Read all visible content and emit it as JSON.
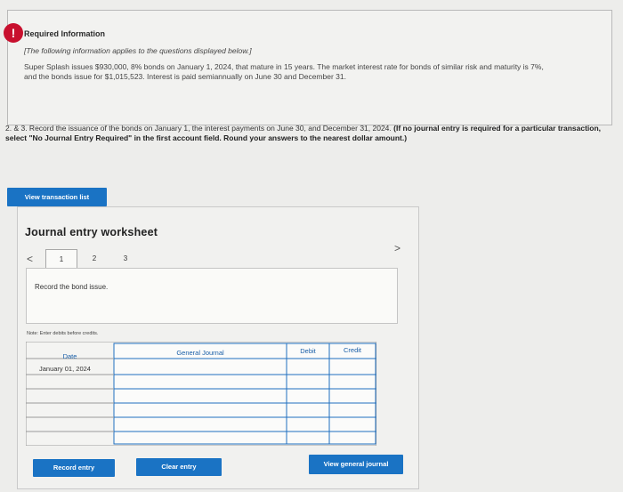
{
  "info": {
    "icon": "!",
    "title": "Required Information",
    "subtitle": "[The following information applies to the questions displayed below.]",
    "body": "Super Splash issues $930,000, 8% bonds on January 1, 2024, that mature in 15 years. The market interest rate for bonds of similar risk and maturity is 7%, and the bonds issue for $1,015,523. Interest is paid semiannually on June 30 and December 31."
  },
  "question": {
    "text": "2. & 3. Record the issuance of the bonds on January 1, the interest payments on June 30, and December 31, 2024.",
    "bold": "(If no journal entry is required for a particular transaction, select \"No Journal Entry Required\" in the first account field. Round your answers to the nearest dollar amount.)"
  },
  "buttons": {
    "view_transaction_list": "View transaction list",
    "record_entry": "Record entry",
    "clear_entry": "Clear entry",
    "view_general_journal": "View general journal"
  },
  "worksheet": {
    "title": "Journal entry worksheet",
    "prev": "<",
    "next": ">",
    "tabs": [
      "1",
      "2",
      "3"
    ],
    "active_tab": "1",
    "entry_description": "Record the bond issue.",
    "note": "Note: Enter debits before credits."
  },
  "table": {
    "headers": {
      "date": "Date",
      "general_journal": "General Journal",
      "debit": "Debit",
      "credit": "Credit"
    },
    "first_date": "January 01, 2024",
    "row_count": 6
  }
}
